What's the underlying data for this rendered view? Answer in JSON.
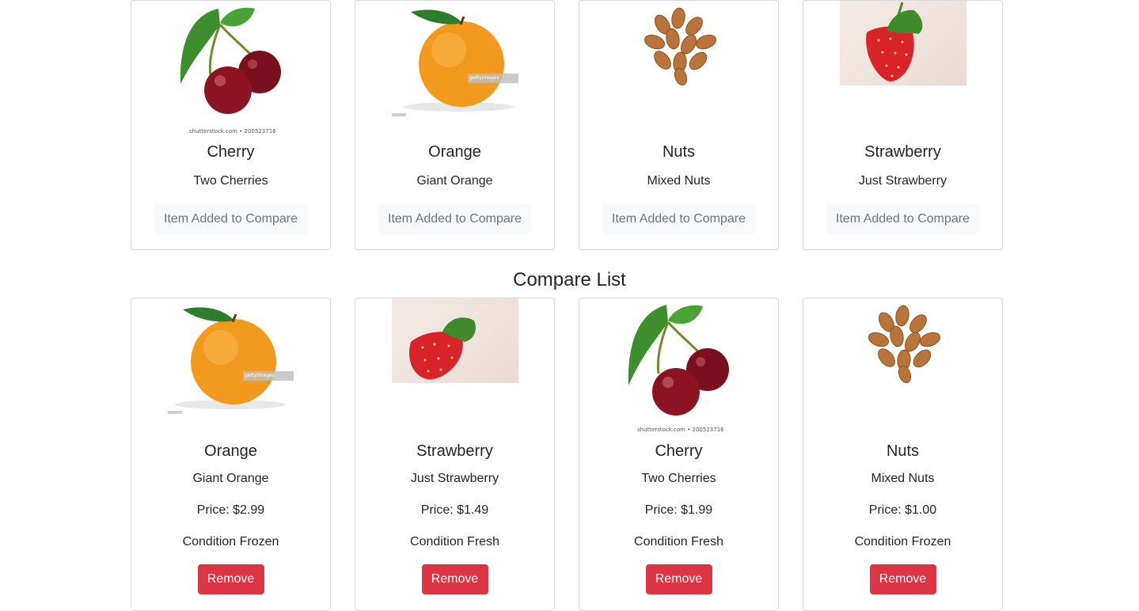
{
  "products": [
    {
      "name": "Cherry",
      "description": "Two Cherries",
      "button": "Item Added to Compare",
      "image": "cherry-image",
      "watermark": "shutterstock.com • 200523716"
    },
    {
      "name": "Orange",
      "description": "Giant Orange",
      "button": "Item Added to Compare",
      "image": "orange-image",
      "watermark": "gettyimages"
    },
    {
      "name": "Nuts",
      "description": "Mixed Nuts",
      "button": "Item Added to Compare",
      "image": "almonds-image"
    },
    {
      "name": "Strawberry",
      "description": "Just Strawberry",
      "button": "Item Added to Compare",
      "image": "strawberry-image"
    }
  ],
  "compare": {
    "title": "Compare List",
    "items": [
      {
        "name": "Orange",
        "description": "Giant Orange",
        "price": "Price: $2.99",
        "condition": "Condition Frozen",
        "button": "Remove",
        "image": "orange-image",
        "watermark": "gettyimages"
      },
      {
        "name": "Strawberry",
        "description": "Just Strawberry",
        "price": "Price: $1.49",
        "condition": "Condition Fresh",
        "button": "Remove",
        "image": "strawberry-image"
      },
      {
        "name": "Cherry",
        "description": "Two Cherries",
        "price": "Price: $1.99",
        "condition": "Condition Fresh",
        "button": "Remove",
        "image": "cherry-image",
        "watermark": "shutterstock.com • 200523716"
      },
      {
        "name": "Nuts",
        "description": "Mixed Nuts",
        "price": "Price: $1.00",
        "condition": "Condition Frozen",
        "button": "Remove",
        "image": "almonds-image"
      }
    ]
  },
  "colors": {
    "danger": "#dc3545",
    "light_button_bg": "#f8f9fa",
    "muted_text": "#6c757d",
    "card_border": "#d9d9d9"
  }
}
